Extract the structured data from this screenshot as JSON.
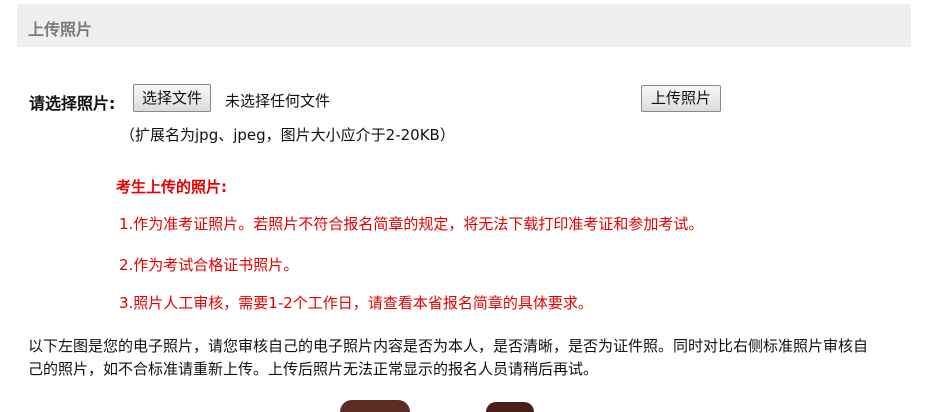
{
  "header": {
    "title": "上传照片"
  },
  "upload": {
    "label": "请选择照片:",
    "choose_file_button": "选择文件",
    "file_status": "未选择任何文件",
    "upload_button": "上传照片",
    "hint": "（扩展名为jpg、jpeg，图片大小应介于2-20KB）"
  },
  "notice": {
    "title": "考生上传的照片:",
    "items": [
      "1.作为准考证照片。若照片不符合报名简章的规定，将无法下载打印准考证和参加考试。",
      "2.作为考试合格证书照片。",
      "3.照片人工审核，需要1-2个工作日，请查看本省报名简章的具体要求。"
    ]
  },
  "description": "以下左图是您的电子照片，请您审核自己的电子照片内容是否为本人，是否清晰，是否为证件照。同时对比右侧标准照片审核自己的照片，如不合标准请重新上传。上传后照片无法正常显示的报名人员请稍后再试。",
  "colors": {
    "header_bg": "#efefef",
    "notice_red": "#e60000"
  }
}
